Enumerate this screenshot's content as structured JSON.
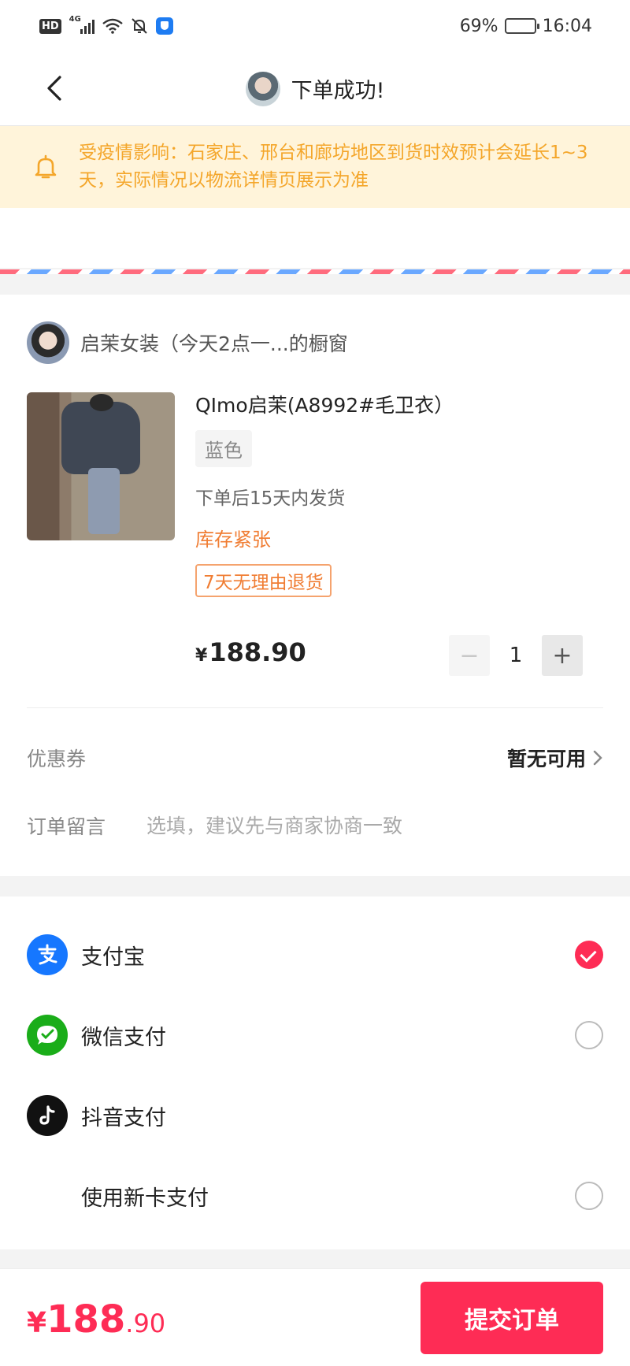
{
  "status_bar": {
    "hd": "HD",
    "network": "4G",
    "battery_pct": "69%",
    "battery_level": 0.69,
    "time": "16:04"
  },
  "nav": {
    "title": "下单成功!"
  },
  "notice": {
    "text": "受疫情影响：石家庄、邢台和廊坊地区到货时效预计会延长1~3天，实际情况以物流详情页展示为准"
  },
  "shop": {
    "name": "启茉女装（今天2点一...的橱窗"
  },
  "product": {
    "title": "QImo启茉(A8992#毛卫衣）",
    "variant": "蓝色",
    "shipping": "下单后15天内发货",
    "stock": "库存紧张",
    "returns": "7天无理由退货",
    "currency": "¥",
    "price": "188.90",
    "quantity": "1",
    "minus": "−",
    "plus": "+"
  },
  "coupon": {
    "label": "优惠券",
    "value": "暂无可用"
  },
  "note": {
    "label": "订单留言",
    "placeholder": "选填，建议先与商家协商一致"
  },
  "payment": {
    "methods": [
      {
        "label": "支付宝",
        "icon": "alipay-icon",
        "color": "#1677ff",
        "selected": true
      },
      {
        "label": "微信支付",
        "icon": "wechat-pay-icon",
        "color": "#1aad19",
        "selected": false
      },
      {
        "label": "抖音支付",
        "icon": "douyin-icon",
        "color": "#111111",
        "selected": false
      },
      {
        "label": "使用新卡支付",
        "icon": "",
        "selected": false
      }
    ]
  },
  "footer": {
    "currency": "¥",
    "total_int": "188",
    "total_dec": ".90",
    "submit_label": "提交订单"
  },
  "colors": {
    "accent": "#fe2c55",
    "warning": "#f4a62a",
    "stock": "#f07d33"
  }
}
